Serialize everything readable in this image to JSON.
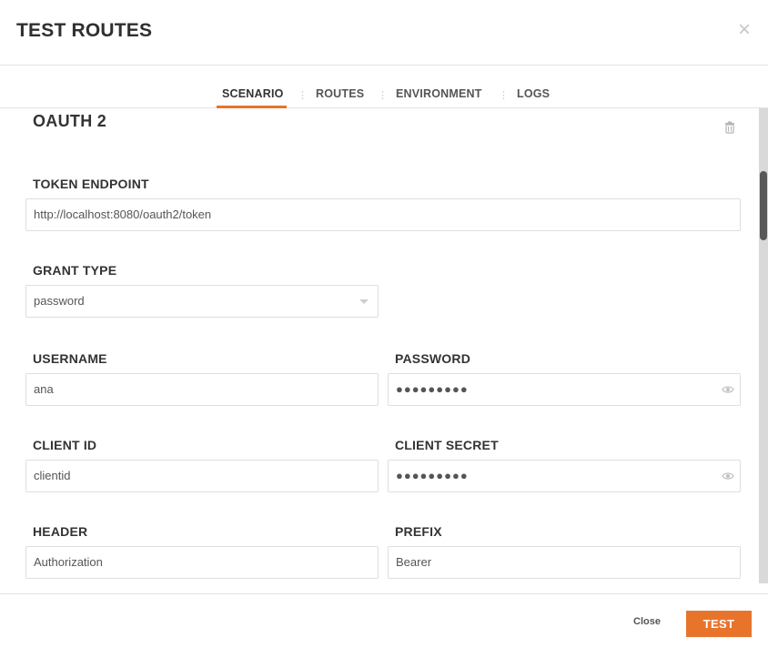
{
  "modal": {
    "title": "TEST ROUTES",
    "close_glyph": "×"
  },
  "tabs": [
    {
      "label": "SCENARIO",
      "active": true
    },
    {
      "label": "ROUTES",
      "active": false
    },
    {
      "label": "ENVIRONMENT",
      "active": false
    },
    {
      "label": "LOGS",
      "active": false
    }
  ],
  "tab_separator": "⋮",
  "section": {
    "title": "OAUTH 2",
    "delete_icon": "trash-icon"
  },
  "fields": {
    "token_endpoint": {
      "label": "TOKEN ENDPOINT",
      "value": "http://localhost:8080/oauth2/token"
    },
    "grant_type": {
      "label": "GRANT TYPE",
      "value": "password"
    },
    "username": {
      "label": "USERNAME",
      "value": "ana"
    },
    "password": {
      "label": "PASSWORD",
      "value": "●●●●●●●●●"
    },
    "client_id": {
      "label": "CLIENT ID",
      "value": "clientid"
    },
    "client_secret": {
      "label": "CLIENT SECRET",
      "value": "●●●●●●●●●"
    },
    "header": {
      "label": "HEADER",
      "value": "Authorization"
    },
    "prefix": {
      "label": "PREFIX",
      "value": "Bearer"
    }
  },
  "footer": {
    "close_label": "Close",
    "test_label": "TEST"
  },
  "colors": {
    "accent": "#e8742b",
    "scroll_thumb": "#585858",
    "border": "#dedede"
  }
}
